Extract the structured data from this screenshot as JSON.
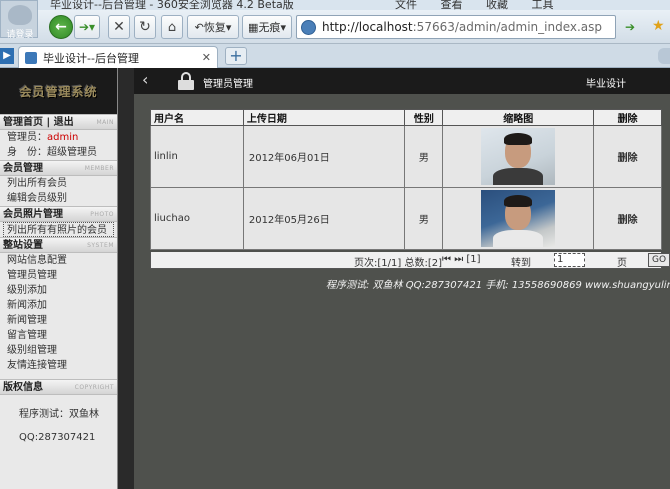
{
  "browser": {
    "window_title": "毕业设计--后台管理 - 360安全浏览器 4.2 Beta版",
    "menu": [
      "文件",
      "查看",
      "收藏",
      "工具"
    ],
    "profile_label": "请登录",
    "restore_label": "恢复",
    "noimage_label": "无痕",
    "url_host": "http://localhost",
    "url_rest": ":57663/admin/admin_index.asp",
    "tab_title": "毕业设计--后台管理",
    "icons": {
      "back": "back-icon",
      "forward": "forward-icon",
      "stop": "stop-icon",
      "refresh": "refresh-icon",
      "home": "home-icon",
      "go": "go-icon",
      "favorite": "star-icon"
    }
  },
  "sidebar": {
    "logo": "会员管理系统",
    "sections": {
      "home": {
        "title": "管理首页 | 退出",
        "tag": "MAIN"
      },
      "member": {
        "title": "会员管理",
        "tag": "MEMBER"
      },
      "photo": {
        "title": "会员照片管理",
        "tag": "PHOTO"
      },
      "system": {
        "title": "整站设置",
        "tag": "SYSTEM"
      },
      "copyright": {
        "title": "版权信息",
        "tag": "COPYRIGHT"
      }
    },
    "admin_label": "管理员：",
    "admin_name": "admin",
    "role_label": "身　份：",
    "role_value": "超级管理员",
    "member_items": [
      "列出所有会员",
      "编辑会员级别"
    ],
    "photo_items": [
      "列出所有有照片的会员"
    ],
    "system_items": [
      "网站信息配置",
      "管理员管理",
      "级别添加",
      "新闻添加",
      "新闻管理",
      "留言管理",
      "级别组管理",
      "友情连接管理"
    ],
    "copyright_lines": [
      "程序测试：双鱼林",
      "QQ:287307421"
    ]
  },
  "topbar": {
    "title": "管理员管理",
    "right": "毕业设计",
    "back_icon": "chevron-left-icon",
    "lock_icon": "lock-icon"
  },
  "table": {
    "headers": [
      "用户名",
      "上传日期",
      "性别",
      "缩略图",
      "删除"
    ],
    "rows": [
      {
        "user": "linlin",
        "date": "2012年06月01日",
        "sex": "男",
        "delete": "删除"
      },
      {
        "user": "liuchao",
        "date": "2012年05月26日",
        "sex": "男",
        "delete": "删除"
      }
    ]
  },
  "pager": {
    "info": "页次:[1/1] 总数:[2]",
    "nav_first": "⏮",
    "nav_last": "⏭",
    "nav_page": "[1]",
    "jump_label": "转到",
    "jump_value": "1",
    "unit": "页",
    "go": "GO"
  },
  "footer": "程序测试: 双鱼林   QQ:287307421   手机: 13558690869 www.shuangyulin.com"
}
